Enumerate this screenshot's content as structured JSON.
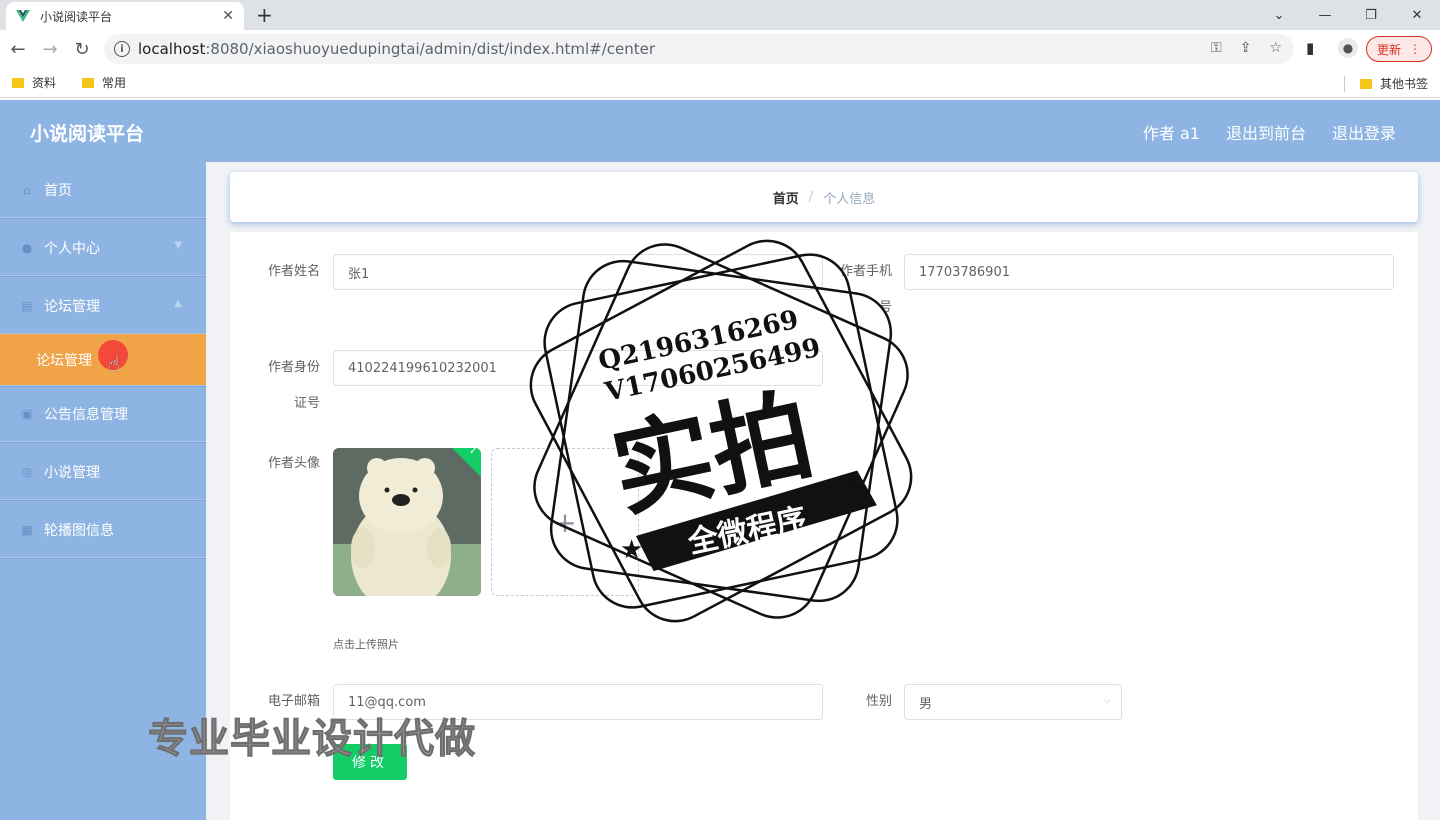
{
  "browser": {
    "tab_title": "小说阅读平台",
    "url_host": "localhost",
    "url_rest": ":8080/xiaoshuoyuedupingtai/admin/dist/index.html#/center",
    "update_label": "更新",
    "bookmarks": [
      "资料",
      "常用"
    ],
    "other_bookmarks": "其他书签"
  },
  "header": {
    "title": "小说阅读平台",
    "user": "作者 a1",
    "to_front": "退出到前台",
    "logout": "退出登录"
  },
  "sidebar": {
    "items": [
      {
        "label": "首页",
        "icon": "home-icon"
      },
      {
        "label": "个人中心",
        "icon": "user-icon"
      },
      {
        "label": "论坛管理",
        "icon": "forum-icon"
      },
      {
        "label": "论坛管理",
        "icon": ""
      },
      {
        "label": "公告信息管理",
        "icon": "notice-icon"
      },
      {
        "label": "小说管理",
        "icon": "book-icon"
      },
      {
        "label": "轮播图信息",
        "icon": "grid-icon"
      }
    ]
  },
  "breadcrumb": {
    "home": "首页",
    "separator": "/",
    "current": "个人信息"
  },
  "form": {
    "name_label": "作者姓名",
    "name_value": "张1",
    "phone_label": "作者手机",
    "phone_suffix": "号",
    "phone_value": "17703786901",
    "id_label_line1": "作者身份",
    "id_label_line2": "证号",
    "id_value": "410224199610232001",
    "avatar_label": "作者头像",
    "upload_tip": "点击上传照片",
    "email_label": "电子邮箱",
    "email_value": "11@qq.com",
    "gender_label": "性别",
    "gender_value": "男",
    "submit_label": "修改"
  },
  "watermark": {
    "line1": "Q2196316269",
    "line2": "V17060256499",
    "big": "实拍",
    "banner": "全微程序",
    "overlay": "专业毕业设计代做"
  },
  "colors": {
    "header_bg": "#8eb4e3",
    "active_menu": "#f0a347",
    "submit": "#13ce66"
  }
}
